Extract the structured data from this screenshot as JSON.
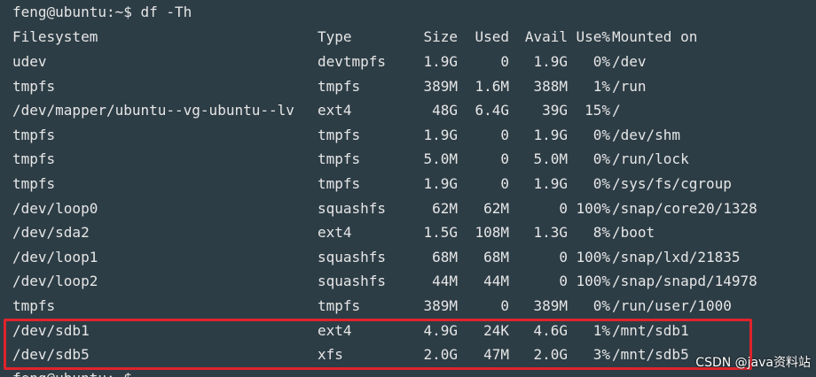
{
  "terminal": {
    "command_line": "feng@ubuntu:~$ df -Th",
    "header": {
      "filesystem": "Filesystem",
      "type": "Type",
      "size": "Size",
      "used": "Used",
      "avail": "Avail",
      "usep": "Use%",
      "mounted": "Mounted on"
    },
    "rows": [
      {
        "filesystem": "udev",
        "type": "devtmpfs",
        "size": "1.9G",
        "used": "0",
        "avail": "1.9G",
        "usep": "0%",
        "mounted": "/dev"
      },
      {
        "filesystem": "tmpfs",
        "type": "tmpfs",
        "size": "389M",
        "used": "1.6M",
        "avail": "388M",
        "usep": "1%",
        "mounted": "/run"
      },
      {
        "filesystem": "/dev/mapper/ubuntu--vg-ubuntu--lv",
        "type": "ext4",
        "size": "48G",
        "used": "6.4G",
        "avail": "39G",
        "usep": "15%",
        "mounted": "/"
      },
      {
        "filesystem": "tmpfs",
        "type": "tmpfs",
        "size": "1.9G",
        "used": "0",
        "avail": "1.9G",
        "usep": "0%",
        "mounted": "/dev/shm"
      },
      {
        "filesystem": "tmpfs",
        "type": "tmpfs",
        "size": "5.0M",
        "used": "0",
        "avail": "5.0M",
        "usep": "0%",
        "mounted": "/run/lock"
      },
      {
        "filesystem": "tmpfs",
        "type": "tmpfs",
        "size": "1.9G",
        "used": "0",
        "avail": "1.9G",
        "usep": "0%",
        "mounted": "/sys/fs/cgroup"
      },
      {
        "filesystem": "/dev/loop0",
        "type": "squashfs",
        "size": "62M",
        "used": "62M",
        "avail": "0",
        "usep": "100%",
        "mounted": "/snap/core20/1328"
      },
      {
        "filesystem": "/dev/sda2",
        "type": "ext4",
        "size": "1.5G",
        "used": "108M",
        "avail": "1.3G",
        "usep": "8%",
        "mounted": "/boot"
      },
      {
        "filesystem": "/dev/loop1",
        "type": "squashfs",
        "size": "68M",
        "used": "68M",
        "avail": "0",
        "usep": "100%",
        "mounted": "/snap/lxd/21835"
      },
      {
        "filesystem": "/dev/loop2",
        "type": "squashfs",
        "size": "44M",
        "used": "44M",
        "avail": "0",
        "usep": "100%",
        "mounted": "/snap/snapd/14978"
      },
      {
        "filesystem": "tmpfs",
        "type": "tmpfs",
        "size": "389M",
        "used": "0",
        "avail": "389M",
        "usep": "0%",
        "mounted": "/run/user/1000"
      },
      {
        "filesystem": "/dev/sdb1",
        "type": "ext4",
        "size": "4.9G",
        "used": "24K",
        "avail": "4.6G",
        "usep": "1%",
        "mounted": "/mnt/sdb1"
      },
      {
        "filesystem": "/dev/sdb5",
        "type": "xfs",
        "size": "2.0G",
        "used": "47M",
        "avail": "2.0G",
        "usep": "3%",
        "mounted": "/mnt/sdb5"
      }
    ],
    "next_prompt": "feng@ubuntu:~$"
  },
  "watermark": "CSDN @java资料站",
  "colors": {
    "background": "#2d3d46",
    "text": "#e6e6e6",
    "highlight_border": "#e0232b"
  }
}
